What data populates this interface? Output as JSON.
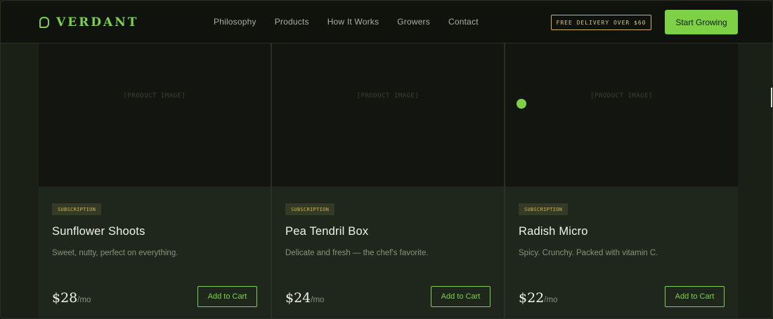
{
  "brand": {
    "name": "VERDANT"
  },
  "nav": {
    "links": [
      "Philosophy",
      "Products",
      "How It Works",
      "Growers",
      "Contact"
    ],
    "promo": "FREE DELIVERY OVER $60",
    "cta": "Start Growing"
  },
  "products": [
    {
      "image_placeholder": "[PRODUCT IMAGE]",
      "badge": "SUBSCRIPTION",
      "name": "Sunflower Shoots",
      "description": "Sweet, nutty, perfect on everything.",
      "price": "$28",
      "unit": "/mo",
      "button": "Add to Cart"
    },
    {
      "image_placeholder": "[PRODUCT IMAGE]",
      "badge": "SUBSCRIPTION",
      "name": "Pea Tendril Box",
      "description": "Delicate and fresh — the chef's favorite.",
      "price": "$24",
      "unit": "/mo",
      "button": "Add to Cart"
    },
    {
      "image_placeholder": "[PRODUCT IMAGE]",
      "badge": "SUBSCRIPTION",
      "name": "Radish Micro",
      "description": "Spicy. Crunchy. Packed with vitamin C.",
      "price": "$22",
      "unit": "/mo",
      "button": "Add to Cart"
    }
  ],
  "colors": {
    "accent": "#7ed145",
    "gold": "#c9b15e",
    "nav_bg": "#10130d",
    "card_bg": "#1f261b"
  }
}
